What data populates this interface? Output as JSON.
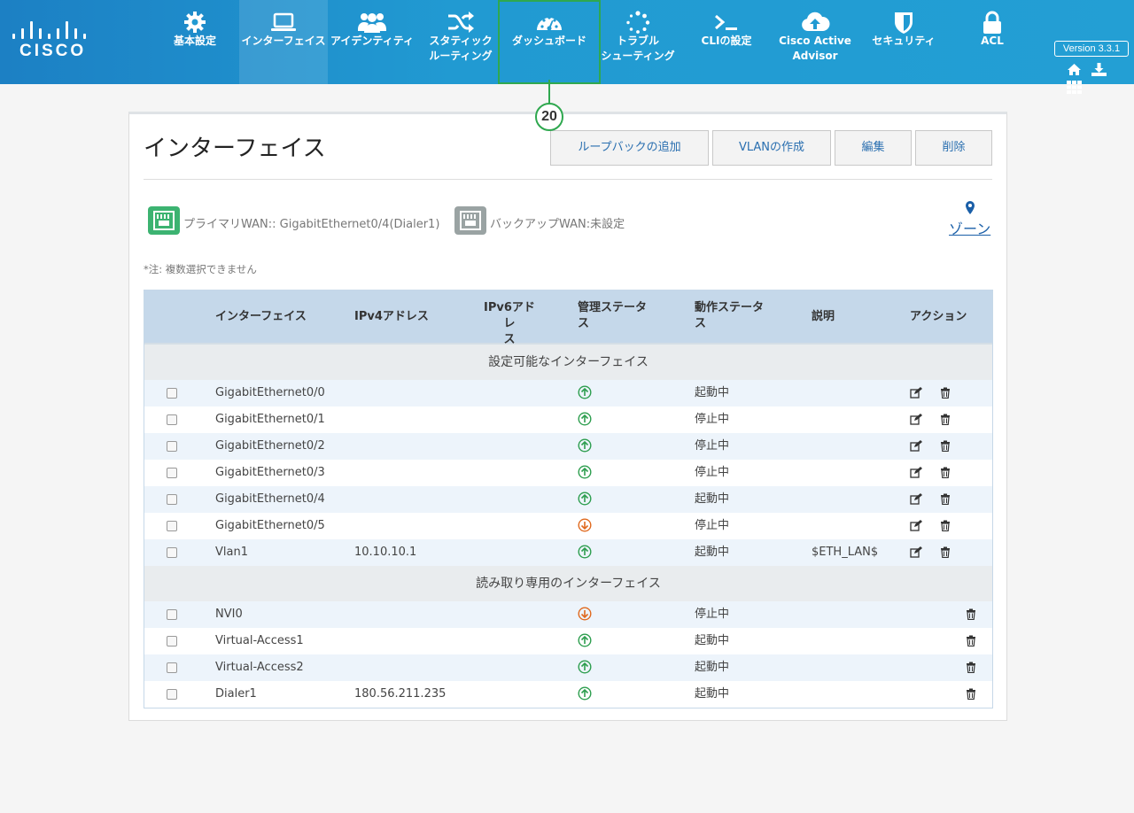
{
  "brand": {
    "logo_text": "CISCO"
  },
  "nav": {
    "items": [
      {
        "label": "基本設定",
        "icon": "gear-icon"
      },
      {
        "label": "インターフェイス",
        "icon": "laptop-icon",
        "active": true
      },
      {
        "label": "アイデンティティ",
        "icon": "users-icon"
      },
      {
        "label": "スタティック\nルーティング",
        "icon": "shuffle-icon"
      },
      {
        "label": "ダッシュボード",
        "icon": "dashboard-gauge-icon",
        "highlighted": true
      },
      {
        "label": "トラブル\nシューティング",
        "icon": "spinner-icon"
      },
      {
        "label": "CLIの設定",
        "icon": "terminal-icon"
      },
      {
        "label": "Cisco Active\nAdvisor",
        "icon": "cloud-upload-icon"
      },
      {
        "label": "セキュリティ",
        "icon": "shield-icon"
      },
      {
        "label": "ACL",
        "icon": "lock-icon"
      }
    ],
    "version": "Version 3.3.1",
    "utility_icons": [
      "home-icon",
      "download-icon",
      "grid-icon"
    ]
  },
  "callout": {
    "number": "20",
    "color": "#2fa84f"
  },
  "page": {
    "title": "インターフェイス",
    "buttons": {
      "add_loopback": "ループバックの追加",
      "create_vlan": "VLANの作成",
      "edit": "編集",
      "delete": "削除"
    },
    "primary_wan": "プライマリWAN:: GigabitEthernet0/4(Dialer1)",
    "backup_wan": "バックアップWAN:未設定",
    "zone_link": "ゾーン",
    "note": "*注: 複数選択できません"
  },
  "table": {
    "headers": {
      "interface": "インターフェイス",
      "ipv4": "IPv4アドレス",
      "ipv6": "IPv6アドレ\nス",
      "admin_status": "管理ステータ\nス",
      "oper_status": "動作ステータ\nス",
      "description": "説明",
      "action": "アクション"
    },
    "configurable_section": "設定可能なインターフェイス",
    "configurable_rows": [
      {
        "name": "GigabitEthernet0/0",
        "ipv4": "",
        "ipv6": "",
        "admin": "up",
        "oper": "起動中",
        "desc": ""
      },
      {
        "name": "GigabitEthernet0/1",
        "ipv4": "",
        "ipv6": "",
        "admin": "up",
        "oper": "停止中",
        "desc": ""
      },
      {
        "name": "GigabitEthernet0/2",
        "ipv4": "",
        "ipv6": "",
        "admin": "up",
        "oper": "停止中",
        "desc": ""
      },
      {
        "name": "GigabitEthernet0/3",
        "ipv4": "",
        "ipv6": "",
        "admin": "up",
        "oper": "停止中",
        "desc": ""
      },
      {
        "name": "GigabitEthernet0/4",
        "ipv4": "",
        "ipv6": "",
        "admin": "up",
        "oper": "起動中",
        "desc": ""
      },
      {
        "name": "GigabitEthernet0/5",
        "ipv4": "",
        "ipv6": "",
        "admin": "down",
        "oper": "停止中",
        "desc": ""
      },
      {
        "name": "Vlan1",
        "ipv4": "10.10.10.1",
        "ipv6": "",
        "admin": "up",
        "oper": "起動中",
        "desc": "$ETH_LAN$"
      }
    ],
    "readonly_section": "読み取り専用のインターフェイス",
    "readonly_rows": [
      {
        "name": "NVI0",
        "ipv4": "",
        "ipv6": "",
        "admin": "down",
        "oper": "停止中",
        "desc": ""
      },
      {
        "name": "Virtual-Access1",
        "ipv4": "",
        "ipv6": "",
        "admin": "up",
        "oper": "起動中",
        "desc": ""
      },
      {
        "name": "Virtual-Access2",
        "ipv4": "",
        "ipv6": "",
        "admin": "up",
        "oper": "起動中",
        "desc": ""
      },
      {
        "name": "Dialer1",
        "ipv4": "180.56.211.235",
        "ipv6": "",
        "admin": "up",
        "oper": "起動中",
        "desc": ""
      }
    ]
  },
  "colors": {
    "nav_bg": "#219ad2",
    "status_up": "#2e9e4f",
    "status_down": "#e06a1f",
    "wan_primary": "#3cb371",
    "wan_backup": "#9aa3a3",
    "link": "#1a5fa8"
  }
}
